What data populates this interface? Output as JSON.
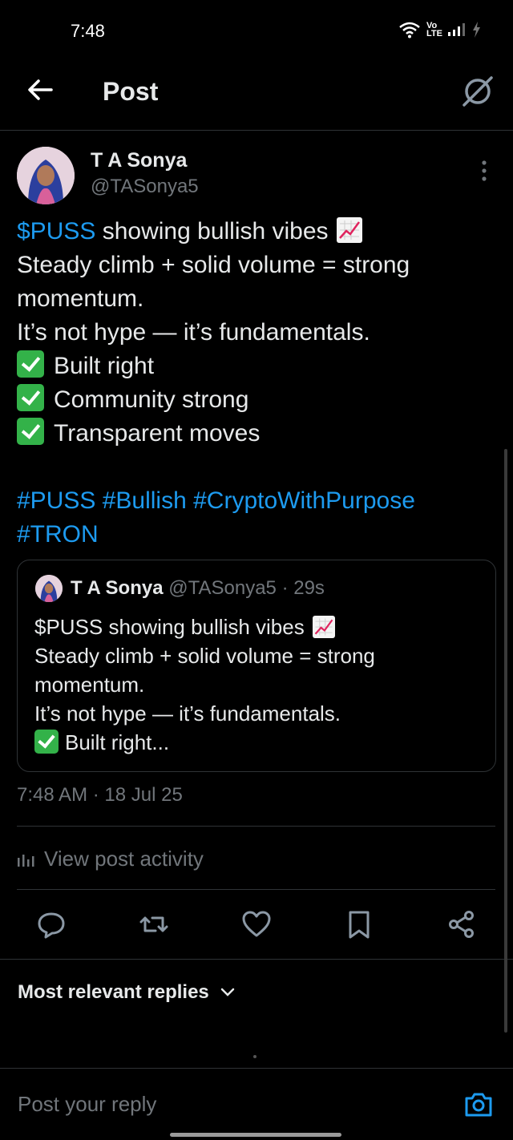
{
  "status": {
    "time": "7:48",
    "network": "Vo LTE"
  },
  "header": {
    "title": "Post"
  },
  "post": {
    "author_name": "T A Sonya",
    "author_handle": "@TASonya5",
    "ticker": "$PUSS",
    "line1_rest": " showing bullish vibes",
    "line2": "Steady climb + solid volume = strong",
    "line3": "momentum.",
    "line4": "It’s not hype — it’s fundamentals.",
    "check1": "Built right",
    "check2": "Community strong",
    "check3": "Transparent moves",
    "hashtags_line1": "#PUSS #Bullish #CryptoWithPurpose",
    "hashtags_line2": "#TRON",
    "timestamp": "7:48 AM · 18 Jul 25"
  },
  "quote": {
    "name": "T A Sonya",
    "meta": " @TASonya5 · 29s",
    "line1": "$PUSS showing bullish vibes",
    "line2": "Steady climb + solid volume = strong",
    "line3": "momentum.",
    "line4": "It’s not hype — it’s fundamentals.",
    "line5": "Built right..."
  },
  "activity": {
    "label": "View post activity"
  },
  "actions": [
    "reply-icon",
    "repost-icon",
    "like-icon",
    "bookmark-icon",
    "share-icon"
  ],
  "replies": {
    "sort_label": "Most relevant replies"
  },
  "composer": {
    "placeholder": "Post your reply"
  },
  "colors": {
    "link": "#1d9bf0",
    "muted": "#71767b",
    "divider": "#2f3336",
    "check": "#33b249"
  }
}
